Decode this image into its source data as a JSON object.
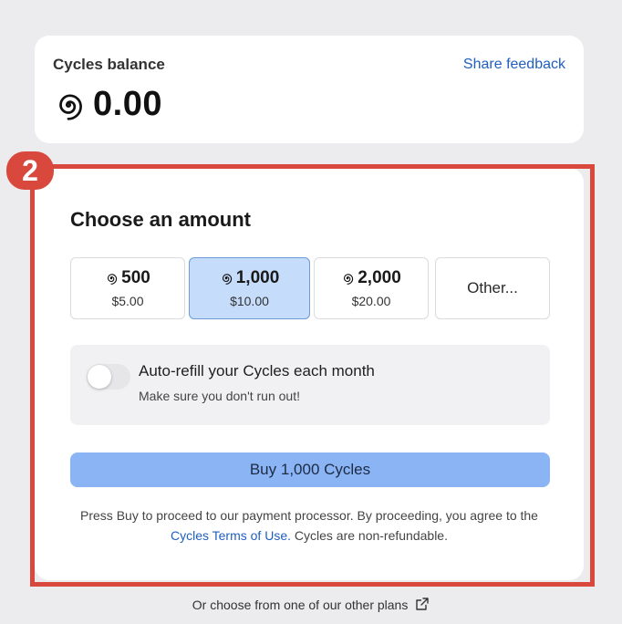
{
  "balance": {
    "label": "Cycles balance",
    "value": "0.00",
    "share_feedback": "Share feedback"
  },
  "step_badge": "2",
  "amount": {
    "title": "Choose an amount",
    "options": [
      {
        "cycles": "500",
        "price": "$5.00",
        "selected": false
      },
      {
        "cycles": "1,000",
        "price": "$10.00",
        "selected": true
      },
      {
        "cycles": "2,000",
        "price": "$20.00",
        "selected": false
      }
    ],
    "other_label": "Other..."
  },
  "auto_refill": {
    "title": "Auto-refill your Cycles each month",
    "subtitle": "Make sure you don't run out!",
    "enabled": false
  },
  "buy_button": "Buy 1,000 Cycles",
  "terms": {
    "prefix": "Press Buy to proceed to our payment processor. By proceeding, you agree to the",
    "link": "Cycles Terms of Use.",
    "suffix": "Cycles are non-refundable."
  },
  "footer": {
    "text": "Or choose from one of our other plans"
  },
  "colors": {
    "accent_red": "#d9483c",
    "selected_bg": "#c5dcfb",
    "button_blue": "#8ab4f4",
    "link_blue": "#1f5fbf"
  }
}
